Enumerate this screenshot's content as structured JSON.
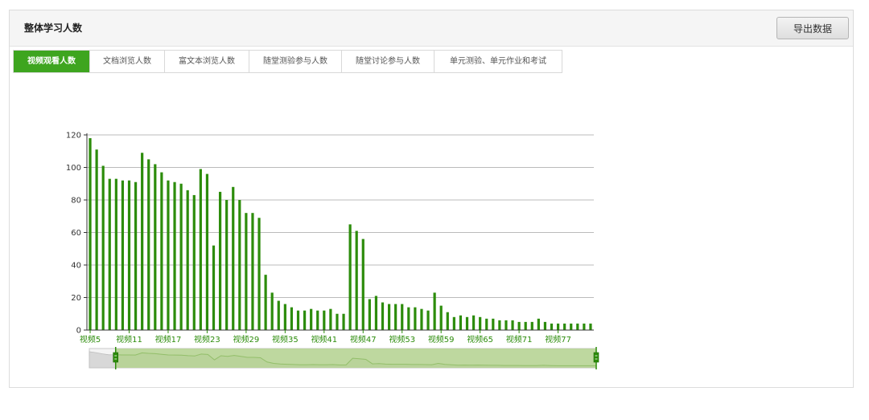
{
  "panel": {
    "title": "整体学习人数",
    "export_label": "导出数据"
  },
  "tabs": [
    {
      "label": "视频观看人数",
      "active": true
    },
    {
      "label": "文档浏览人数",
      "active": false
    },
    {
      "label": "富文本浏览人数",
      "active": false
    },
    {
      "label": "随堂测验参与人数",
      "active": false
    },
    {
      "label": "随堂讨论参与人数",
      "active": false
    },
    {
      "label": "单元测验、单元作业和考试",
      "active": false
    }
  ],
  "colors": {
    "accent": "#3ea51f",
    "bar": "#2c8c0b",
    "zoom_fill": "#b4d28f",
    "grid": "#bbbbbb"
  },
  "chart_data": {
    "type": "bar",
    "categories": [
      "视频5",
      "视频6",
      "视频7",
      "视频8",
      "视频9",
      "视频10",
      "视频11",
      "视频12",
      "视频13",
      "视频14",
      "视频15",
      "视频16",
      "视频17",
      "视频18",
      "视频19",
      "视频20",
      "视频21",
      "视频22",
      "视频23",
      "视频24",
      "视频25",
      "视频26",
      "视频27",
      "视频28",
      "视频29",
      "视频30",
      "视频31",
      "视频32",
      "视频33",
      "视频34",
      "视频35",
      "视频36",
      "视频37",
      "视频38",
      "视频39",
      "视频40",
      "视频41",
      "视频42",
      "视频43",
      "视频44",
      "视频45",
      "视频46",
      "视频47",
      "视频48",
      "视频49",
      "视频50",
      "视频51",
      "视频52",
      "视频53",
      "视频54",
      "视频55",
      "视频56",
      "视频57",
      "视频58",
      "视频59",
      "视频60",
      "视频61",
      "视频62",
      "视频63",
      "视频64",
      "视频65",
      "视频66",
      "视频67",
      "视频68",
      "视频69",
      "视频70",
      "视频71",
      "视频72",
      "视频73",
      "视频74",
      "视频75",
      "视频76",
      "视频77",
      "视频78",
      "视频79",
      "视频80",
      "视频81",
      "视频82"
    ],
    "values": [
      118,
      111,
      101,
      93,
      93,
      92,
      92,
      91,
      109,
      105,
      102,
      97,
      92,
      91,
      90,
      86,
      83,
      99,
      96,
      52,
      85,
      80,
      88,
      80,
      72,
      72,
      69,
      34,
      23,
      18,
      16,
      14,
      12,
      12,
      13,
      12,
      12,
      13,
      10,
      10,
      65,
      61,
      56,
      19,
      21,
      17,
      16,
      16,
      16,
      14,
      14,
      13,
      12,
      23,
      15,
      11,
      8,
      9,
      8,
      9,
      8,
      7,
      7,
      6,
      6,
      6,
      5,
      5,
      5,
      7,
      5,
      4,
      4,
      4,
      4,
      4,
      4,
      4
    ],
    "x_tick_labels": [
      "视频5",
      "视频11",
      "视频17",
      "视频23",
      "视频29",
      "视频35",
      "视频41",
      "视频47",
      "视频53",
      "视频59",
      "视频65",
      "视频71",
      "视频77"
    ],
    "y_ticks": [
      0,
      20,
      40,
      60,
      80,
      100,
      120
    ],
    "ylim": [
      0,
      120
    ],
    "grid": true,
    "zoom_range": [
      "视频9",
      "视频82"
    ],
    "title": "",
    "xlabel": "",
    "ylabel": ""
  }
}
